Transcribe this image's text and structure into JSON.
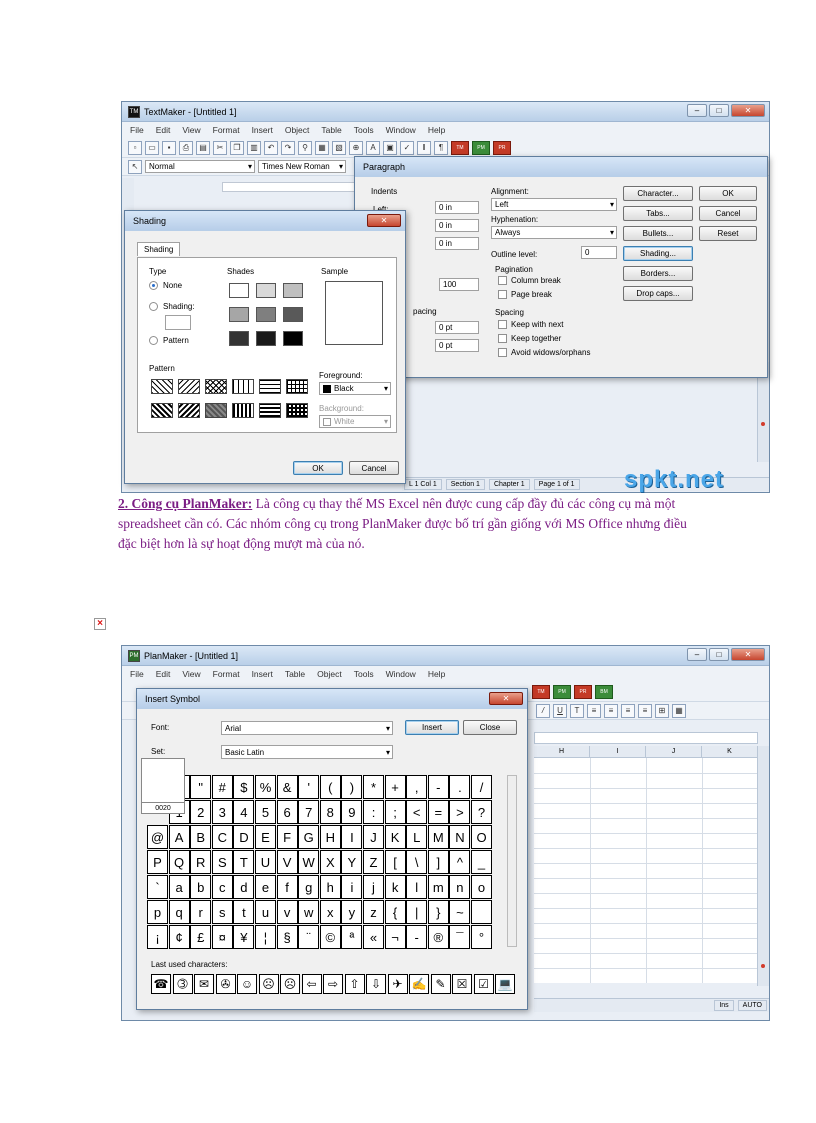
{
  "screenshot1": {
    "window_title": "TextMaker - [Untitled 1]",
    "app_icon": "TM",
    "menu": [
      "File",
      "Edit",
      "View",
      "Format",
      "Insert",
      "Object",
      "Table",
      "Tools",
      "Window",
      "Help"
    ],
    "style_combo": "Normal",
    "font_combo": "Times New Roman",
    "paragraph": {
      "title": "Paragraph",
      "indents_label": "Indents",
      "left_label": "Left:",
      "indent_values": [
        "0 in",
        "0 in",
        "0 in"
      ],
      "spacing_value": "100",
      "spacing_label": "pacing",
      "spacing_values": [
        "0 pt",
        "0 pt"
      ],
      "alignment_label": "Alignment:",
      "alignment_value": "Left",
      "hyphenation_label": "Hyphenation:",
      "hyphenation_value": "Always",
      "outline_label": "Outline level:",
      "outline_value": "0",
      "pagination_label": "Pagination",
      "column_break": "Column break",
      "page_break": "Page break",
      "spacing_group_label": "Spacing",
      "keep_next": "Keep with next",
      "keep_together": "Keep together",
      "avoid_widows": "Avoid widows/orphans",
      "buttons": [
        "Character...",
        "Tabs...",
        "Bullets...",
        "Shading...",
        "Borders...",
        "Drop caps..."
      ],
      "ok": "OK",
      "cancel": "Cancel",
      "reset": "Reset"
    },
    "shading": {
      "title": "Shading",
      "tab": "Shading",
      "type_label": "Type",
      "type_none": "None",
      "type_shading": "Shading:",
      "type_pattern": "Pattern",
      "shades_label": "Shades",
      "sample_label": "Sample",
      "pattern_label": "Pattern",
      "foreground_label": "Foreground:",
      "foreground_value": "Black",
      "background_label": "Background:",
      "background_value": "White",
      "ok": "OK",
      "cancel": "Cancel",
      "shade_colors": [
        "#ffffff",
        "#d9d9d9",
        "#bfbfbf",
        "#a6a6a6",
        "#7f7f7f",
        "#595959",
        "#333333",
        "#1a1a1a",
        "#000000"
      ]
    },
    "status": [
      "L 1 Col 1",
      "Section 1",
      "Chapter 1",
      "Page 1 of 1"
    ],
    "watermark": "spkt.net"
  },
  "caption": {
    "heading": "2. Công cụ PlanMaker:",
    "body": " Là công cụ thay thế MS Excel nên được cung cấp đầy đủ các công cụ mà một spreadsheet cần có. Các nhóm công cụ trong PlanMaker được bố trí gần giống với MS Office nhưng điều đặc biệt hơn là sự hoạt động mượt mà của nó."
  },
  "broken_image_icon": "×",
  "screenshot2": {
    "window_title": "PlanMaker - [Untitled 1]",
    "app_icon": "PM",
    "menu": [
      "File",
      "Edit",
      "View",
      "Format",
      "Insert",
      "Table",
      "Object",
      "Tools",
      "Window",
      "Help"
    ],
    "columns": [
      "H",
      "I",
      "J",
      "K"
    ],
    "status": [
      "Ins",
      "AUTO"
    ],
    "insert_symbol": {
      "title": "Insert Symbol",
      "font_label": "Font:",
      "font_value": "Arial",
      "set_label": "Set:",
      "set_value": "Basic Latin",
      "insert": "Insert",
      "close": "Close",
      "code": "0020",
      "last_used_label": "Last used characters:",
      "rows": [
        [
          "",
          "\"",
          "#",
          "$",
          "%",
          "&",
          "'",
          "(",
          ")",
          "*",
          "+",
          ",",
          "-",
          ".",
          "/"
        ],
        [
          "1",
          "2",
          "3",
          "4",
          "5",
          "6",
          "7",
          "8",
          "9",
          ":",
          ";",
          "<",
          "=",
          ">",
          "?"
        ],
        [
          "@",
          "A",
          "B",
          "C",
          "D",
          "E",
          "F",
          "G",
          "H",
          "I",
          "J",
          "K",
          "L",
          "M",
          "N",
          "O"
        ],
        [
          "P",
          "Q",
          "R",
          "S",
          "T",
          "U",
          "V",
          "W",
          "X",
          "Y",
          "Z",
          "[",
          "\\",
          "]",
          "^",
          "_"
        ],
        [
          "`",
          "a",
          "b",
          "c",
          "d",
          "e",
          "f",
          "g",
          "h",
          "i",
          "j",
          "k",
          "l",
          "m",
          "n",
          "o"
        ],
        [
          "p",
          "q",
          "r",
          "s",
          "t",
          "u",
          "v",
          "w",
          "x",
          "y",
          "z",
          "{",
          "|",
          "}",
          "~",
          ""
        ],
        [
          "¡",
          "¢",
          "£",
          "¤",
          "¥",
          "¦",
          "§",
          "¨",
          "©",
          "ª",
          "«",
          "¬",
          "-",
          "®",
          "¯",
          "°"
        ]
      ],
      "last_used": [
        "☎",
        "➂",
        "✉",
        "✇",
        "☺",
        "☹",
        "☹",
        "⇦",
        "⇨",
        "⇧",
        "⇩",
        "✈",
        "✍",
        "✎",
        "☒",
        "☑",
        "💻"
      ]
    }
  }
}
